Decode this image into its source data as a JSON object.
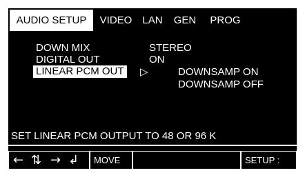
{
  "tabs": [
    {
      "label": "AUDIO SETUP",
      "active": true
    },
    {
      "label": "VIDEO",
      "active": false
    },
    {
      "label": "LAN",
      "active": false
    },
    {
      "label": "GEN",
      "active": false
    },
    {
      "label": "PROG",
      "active": false
    }
  ],
  "menu": {
    "items": [
      {
        "label": "DOWN MIX",
        "value": "STEREO"
      },
      {
        "label": "DIGITAL OUT",
        "value": "ON"
      },
      {
        "label": "LINEAR PCM OUT",
        "selected": true
      }
    ],
    "submenu_arrow": "▷",
    "options": [
      "DOWNSAMP ON",
      "DOWNSAMP OFF"
    ]
  },
  "status_text": "SET LINEAR PCM OUTPUT TO 48 OR 96 K",
  "footer": {
    "arrow_icons": [
      "left-arrow-icon",
      "up-down-arrow-icon",
      "right-arrow-icon",
      "enter-arrow-icon"
    ],
    "move_label": "MOVE",
    "exit_label": "SETUP : Exit"
  },
  "colors": {
    "background": "#000000",
    "foreground": "#ffffff"
  }
}
